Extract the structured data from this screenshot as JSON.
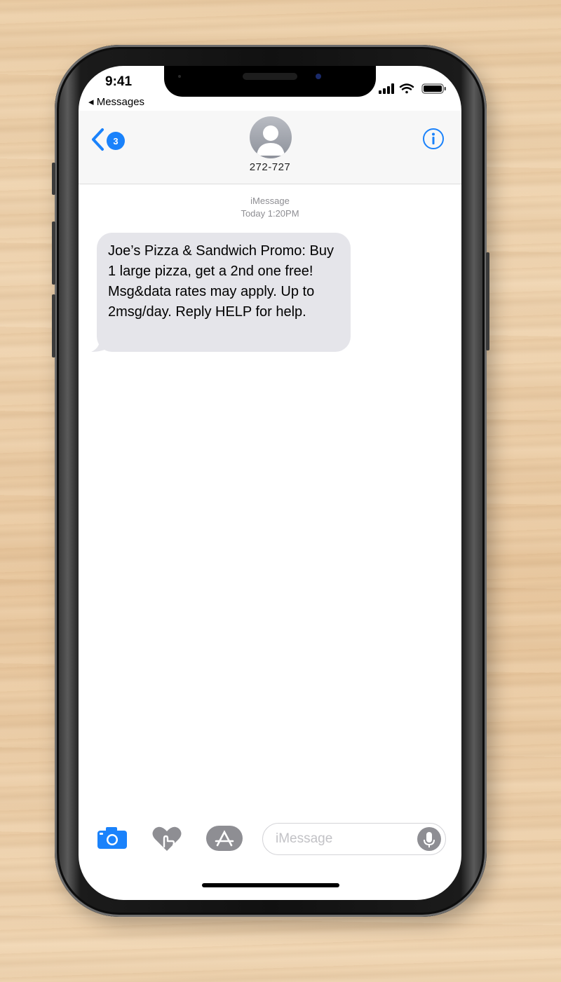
{
  "status_bar": {
    "time": "9:41",
    "back_app": "◂ Messages",
    "icons": [
      "cellular-signal-icon",
      "wifi-icon",
      "battery-icon"
    ]
  },
  "nav": {
    "back_badge_count": "3",
    "contact": "272-727",
    "info_icon": "info-icon"
  },
  "conversation": {
    "service": "iMessage",
    "timestamp": "Today 1:20PM",
    "messages": [
      {
        "direction": "incoming",
        "text": "Joe’s Pizza & Sandwich Promo: Buy 1 large pizza, get a 2nd one free! Msg&data rates may apply. Up to 2msg/day. Reply HELP for help."
      }
    ]
  },
  "composer": {
    "placeholder": "iMessage",
    "tools": [
      "camera-icon",
      "digital-touch-icon",
      "app-store-icon"
    ],
    "mic_icon": "microphone-icon"
  },
  "colors": {
    "accent": "#1a82fb",
    "bubble_incoming": "#e5e5ea",
    "meta_text": "#8e8e93"
  }
}
